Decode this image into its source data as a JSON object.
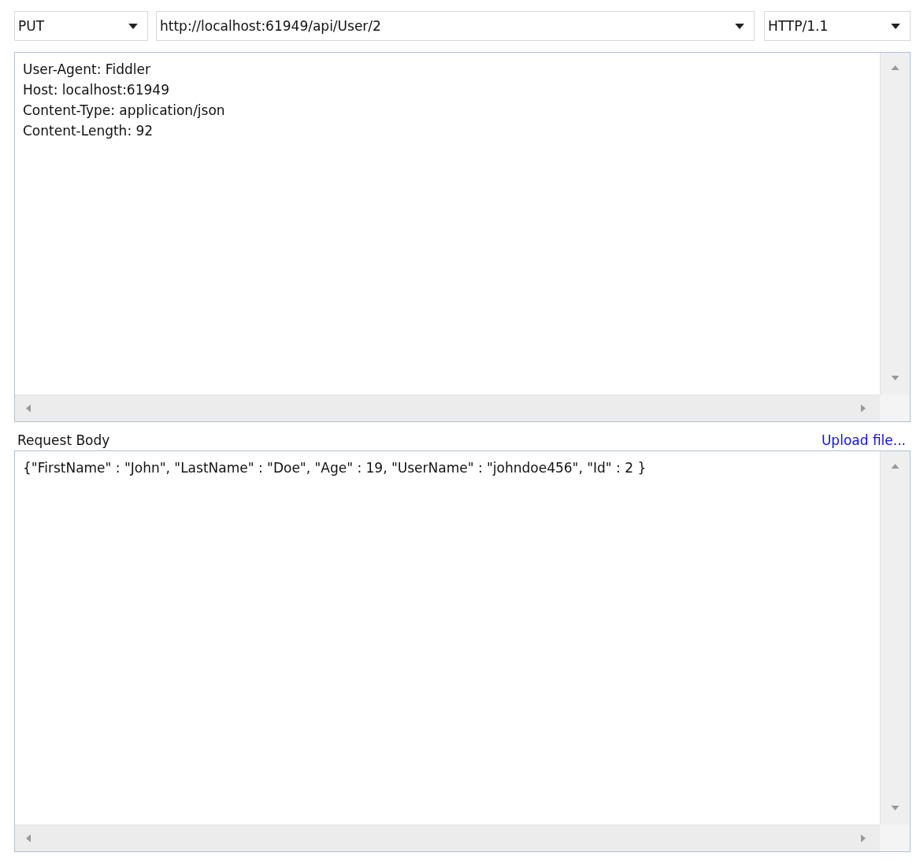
{
  "request_line": {
    "method": "PUT",
    "url": "http://localhost:61949/api/User/2",
    "version": "HTTP/1.1"
  },
  "headers": [
    "User-Agent: Fiddler",
    "Host: localhost:61949",
    "Content-Type: application/json",
    "Content-Length: 92"
  ],
  "body_section": {
    "label": "Request Body",
    "upload_link": "Upload file...",
    "body": "{\"FirstName\" : \"John\", \"LastName\" : \"Doe\", \"Age\" : 19, \"UserName\" : \"johndoe456\", \"Id\" : 2 }"
  }
}
